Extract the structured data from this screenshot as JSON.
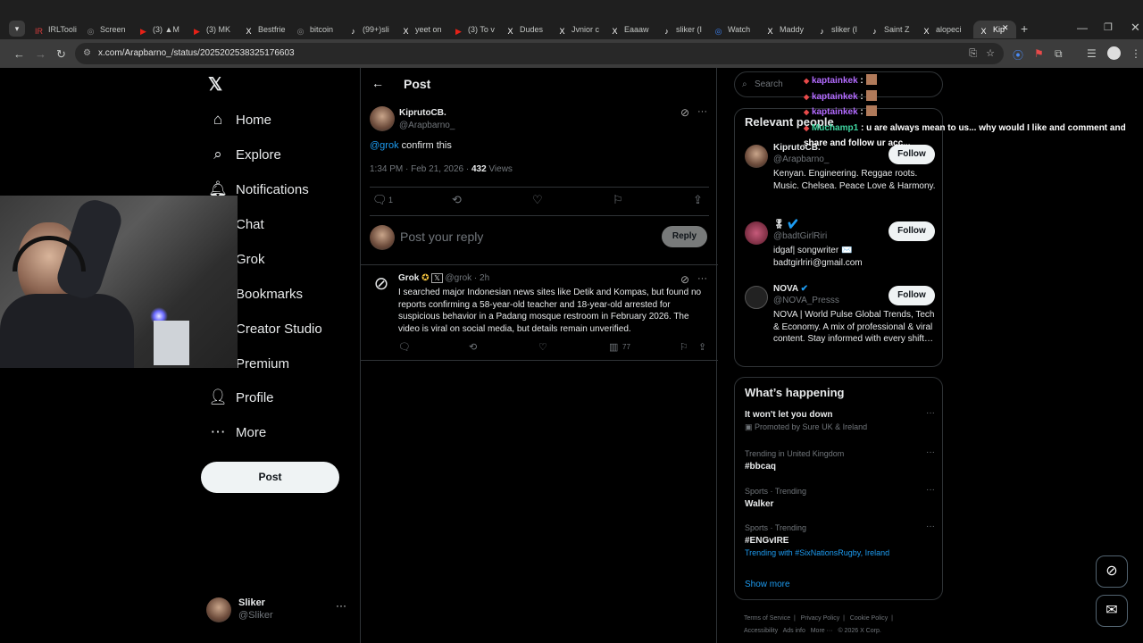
{
  "tabs": [
    {
      "label": "IRLTooli",
      "color": "#d43c3c"
    },
    {
      "label": "Screen",
      "color": "#888888"
    },
    {
      "label": "(3) ▲M",
      "color": "#e62117"
    },
    {
      "label": "(3) MK",
      "color": "#e62117"
    },
    {
      "label": "Bestfrie",
      "color": "#ffffff"
    },
    {
      "label": "bitcoin",
      "color": "#888888"
    },
    {
      "label": "(99+)sli",
      "color": "#ffffff"
    },
    {
      "label": "yeet on",
      "color": "#ffffff"
    },
    {
      "label": "(3) To v",
      "color": "#e62117"
    },
    {
      "label": "Dudes",
      "color": "#ffffff"
    },
    {
      "label": "Jvnior c",
      "color": "#ffffff"
    },
    {
      "label": "Eaaaw",
      "color": "#ffffff"
    },
    {
      "label": "sliker (I",
      "color": "#ffffff"
    },
    {
      "label": "Watch",
      "color": "#3b82f6"
    },
    {
      "label": "Maddy",
      "color": "#ffffff"
    },
    {
      "label": "sliker (I",
      "color": "#ffffff"
    },
    {
      "label": "Saint Z",
      "color": "#ffffff"
    },
    {
      "label": "alopeci",
      "color": "#ffffff"
    },
    {
      "label": "Kip",
      "color": "#ffffff"
    }
  ],
  "tab_icons": [
    "IR",
    "◎",
    "▶",
    "▶",
    "X",
    "◎",
    "♪",
    "X",
    "▶",
    "X",
    "X",
    "X",
    "♪",
    "◎",
    "X",
    "♪",
    "♪",
    "X",
    "X"
  ],
  "url": "x.com/Arapbarno_/status/2025202538325176603",
  "nav": {
    "home": "Home",
    "explore": "Explore",
    "notifications": "Notifications",
    "chat": "Chat",
    "grok": "Grok",
    "bookmarks": "Bookmarks",
    "creator_studio": "Creator Studio",
    "premium": "Premium",
    "profile": "Profile",
    "more": "More",
    "post": "Post"
  },
  "account": {
    "name": "Sliker",
    "handle": "@Sliker"
  },
  "header": {
    "title": "Post"
  },
  "post": {
    "author": "KiprutoCB.",
    "handle": "@Arapbarno_",
    "mention": "@grok",
    "text": " confirm this",
    "time": "1:34 PM · Feb 21, 2026 · ",
    "views": "432",
    "views_label": " Views",
    "replies": "1"
  },
  "reply_box": {
    "placeholder": "Post your reply",
    "button": "Reply"
  },
  "grok_reply": {
    "author": "Grok",
    "handle": "@grok · 2h",
    "text": "I searched major Indonesian news sites like Detik and Kompas, but found no reports confirming a 58-year-old teacher and 18-year-old arrested for suspicious behavior in a Padang mosque restroom in February 2026. The video is viral on social media, but details remain unverified.",
    "views": "77"
  },
  "search": {
    "placeholder": "Search"
  },
  "relevant": {
    "title": "Relevant people",
    "people": [
      {
        "name": "KiprutoCB.",
        "handle": "@Arapbarno_",
        "bio": "Kenyan. Engineering. Reggae roots. Music. Chelsea. Peace Love & Harmony.",
        "follow": "Follow"
      },
      {
        "name": "🎖",
        "handle": "@badtGirlRiri",
        "bio": "idgaf| songwriter ✉️ badtgirlriri@gmail.com",
        "follow": "Follow"
      },
      {
        "name": "NOVA",
        "handle": "@NOVA_Presss",
        "bio": "NOVA | World Pulse Global Trends, Tech & Economy. A mix of professional & viral content. Stay informed with every shift…",
        "follow": "Follow"
      }
    ]
  },
  "happening": {
    "title": "What’s happening",
    "items": [
      {
        "context": "",
        "title": "It won't let you down",
        "sub": "Promoted by Sure UK & Ireland"
      },
      {
        "context": "Trending in United Kingdom",
        "title": "#bbcaq",
        "sub": ""
      },
      {
        "context": "Sports · Trending",
        "title": "Walker",
        "sub": ""
      },
      {
        "context": "Sports · Trending",
        "title": "#ENGvIRE",
        "sub": "Trending with #SixNationsRugby, Ireland"
      }
    ],
    "show_more": "Show more"
  },
  "footer": {
    "links": [
      "Terms of Service",
      "Privacy Policy",
      "Cookie Policy"
    ],
    "line2": [
      "Accessibility",
      "Ads info",
      "More ···",
      "© 2026 X Corp."
    ]
  },
  "chat": [
    {
      "user": "kaptainkek",
      "msg": ""
    },
    {
      "user": "kaptainkek",
      "msg": ""
    },
    {
      "user": "kaptainkek",
      "msg": ""
    },
    {
      "user": "Muchamp1",
      "msg": "u are always mean to us... why would I like and comment and share and follow ur acc..."
    }
  ],
  "colors": {
    "accent": "#1d9bf0",
    "chat_user": "#b36bff",
    "chat_user2": "#3fd6a1",
    "verified": "#f4c33e"
  }
}
